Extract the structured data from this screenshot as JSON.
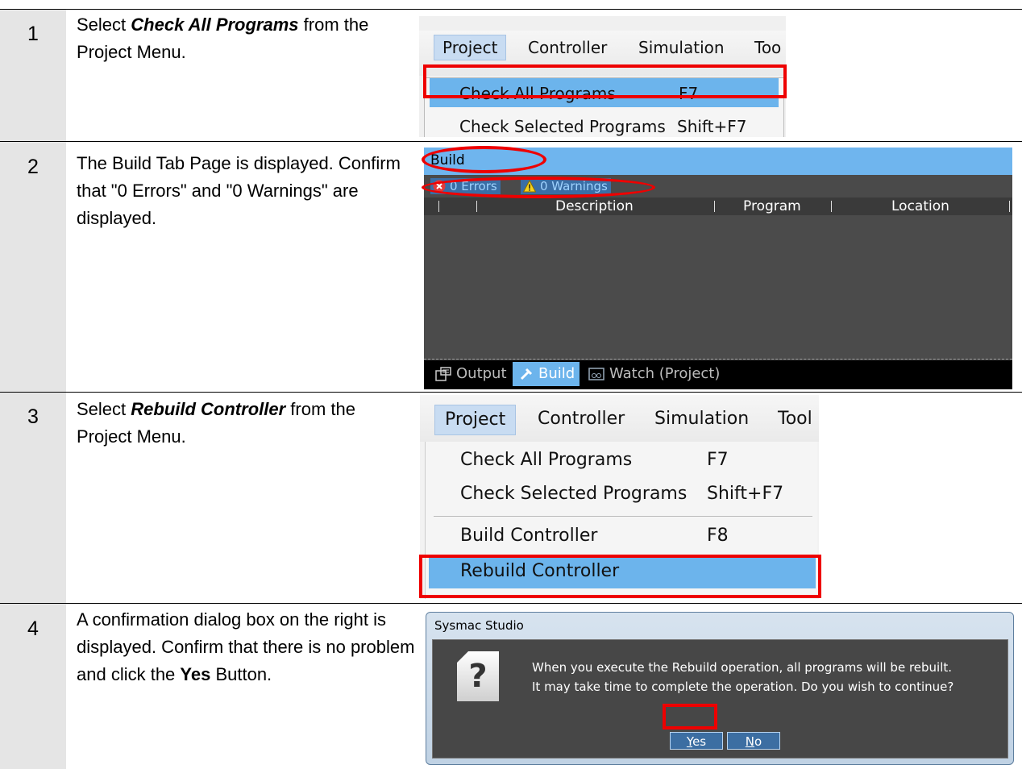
{
  "steps": [
    {
      "number": "1",
      "text": [
        {
          "t": "Select ",
          "b": false,
          "i": false
        },
        {
          "t": "Check All Programs",
          "b": true,
          "i": true
        },
        {
          "t": " from the Project Menu.",
          "b": false,
          "i": false
        }
      ]
    },
    {
      "number": "2",
      "text": [
        {
          "t": "The Build Tab Page is displayed. Confirm that \"0 Errors\" and \"0 Warnings\" are displayed.",
          "b": false,
          "i": false
        }
      ]
    },
    {
      "number": "3",
      "text": [
        {
          "t": "Select ",
          "b": false,
          "i": false
        },
        {
          "t": "Rebuild Controller",
          "b": true,
          "i": true
        },
        {
          "t": " from the Project Menu.",
          "b": false,
          "i": false
        }
      ]
    },
    {
      "number": "4",
      "text": [
        {
          "t": "A confirmation dialog box on the right is displayed. Confirm that there is no problem and click the ",
          "b": false,
          "i": false
        },
        {
          "t": "Yes",
          "b": true,
          "i": false
        },
        {
          "t": " Button.",
          "b": false,
          "i": false
        }
      ]
    }
  ],
  "menu1": {
    "tabs": [
      "Project",
      "Controller",
      "Simulation",
      "Too"
    ],
    "items": [
      {
        "label": "Check All Programs",
        "key": "F7"
      },
      {
        "label": "Check Selected Programs",
        "key": "Shift+F7"
      }
    ]
  },
  "build_panel": {
    "title": "Build",
    "errors": "0  Errors",
    "warnings": "0  Warnings",
    "columns": [
      "Description",
      "Program",
      "Location"
    ],
    "tabs": [
      "Output",
      "Build",
      "Watch (Project)"
    ]
  },
  "menu3": {
    "tabs": [
      "Project",
      "Controller",
      "Simulation",
      "Tool"
    ],
    "items": [
      {
        "label": "Check All Programs",
        "key": "F7"
      },
      {
        "label": "Check Selected Programs",
        "key": "Shift+F7"
      },
      {
        "label": "Build Controller",
        "key": "F8"
      },
      {
        "label": "Rebuild Controller",
        "key": ""
      }
    ]
  },
  "dialog": {
    "title": "Sysmac Studio",
    "icon": "question-icon",
    "message_line1": "When you execute the Rebuild operation, all programs will be rebuilt.",
    "message_line2": "It may take time to complete the operation. Do you wish to continue?",
    "yes_accel": "Y",
    "yes_rest": "es",
    "no_accel": "N",
    "no_rest": "o"
  },
  "colors": {
    "highlight_red": "#ee0000",
    "menu_highlight": "#6cb4ec",
    "step_number_bg": "#e5e5e5"
  }
}
